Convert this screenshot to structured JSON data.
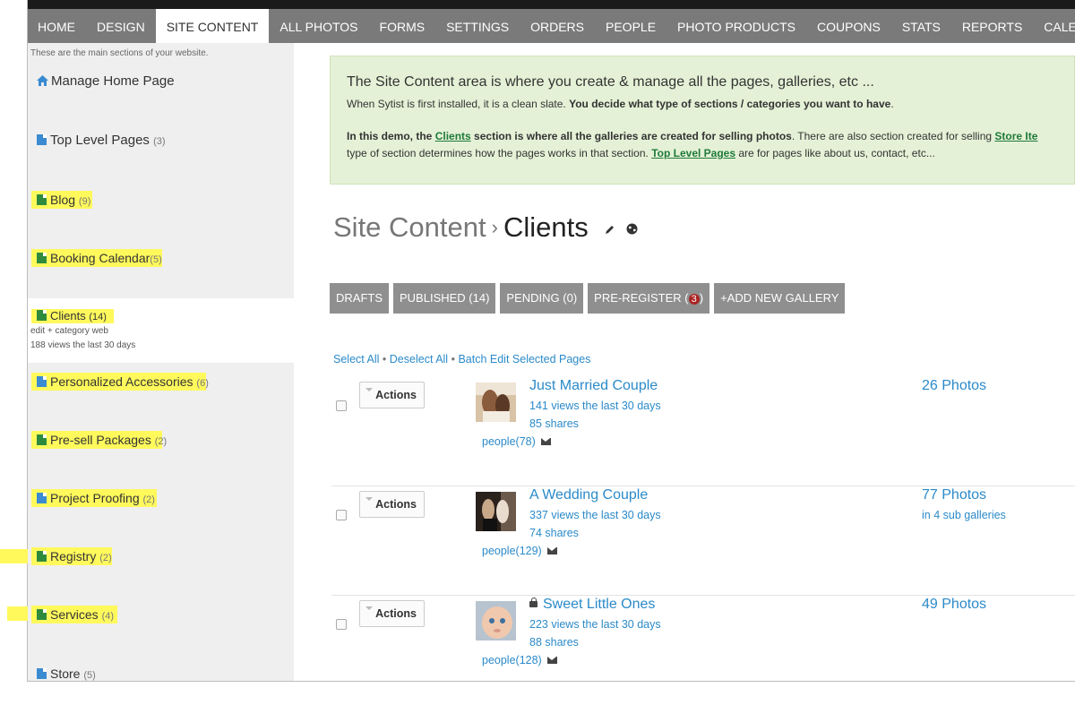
{
  "nav": {
    "items": [
      "HOME",
      "DESIGN",
      "SITE CONTENT",
      "ALL PHOTOS",
      "FORMS",
      "SETTINGS",
      "ORDERS",
      "PEOPLE",
      "PHOTO PRODUCTS",
      "COUPONS",
      "STATS",
      "REPORTS",
      "CALENDAR"
    ],
    "active": "SITE CONTENT"
  },
  "sidebar": {
    "note": "These are the main sections of your website.",
    "manage_home": "Manage Home Page",
    "items": [
      {
        "label": "Top Level Pages",
        "count": "(3)"
      },
      {
        "label": "Blog",
        "count": "(9)"
      },
      {
        "label": "Booking Calendar",
        "count": "(5)"
      },
      {
        "label": "Clients",
        "count": "(14)"
      },
      {
        "label": "Personalized Accessories",
        "count": "(6)"
      },
      {
        "label": "Pre-sell Packages",
        "count": "(2)"
      },
      {
        "label": "Project Proofing",
        "count": "(2)"
      },
      {
        "label": "Registry",
        "count": "(2)"
      },
      {
        "label": "Services",
        "count": "(4)"
      },
      {
        "label": "Store",
        "count": "(5)"
      }
    ],
    "selected_links": "edit   + category   web",
    "selected_views": "188 views the last 30 days"
  },
  "info": {
    "heading": "The Site Content area is where you create & manage all the pages, galleries, etc ...",
    "p1_normal": "When Sytist is first installed, it is a clean slate.",
    "p1_bold": "You decide what type of sections / categories you want to have",
    "p1_end": ".",
    "p2_bold_start": "In this demo, the",
    "p2_link1": "Clients",
    "p2_bold_end": "section is where all the galleries are created for selling photos",
    "p2_normal": ". There are also section created for selling",
    "p2_link2": "Store Ite",
    "p3_normal": "type of section determines how the pages works in that section.",
    "p3_link": "Top Level Pages",
    "p3_end": "are for pages like about us, contact, etc..."
  },
  "page": {
    "breadcrumb_root": "Site Content",
    "separator": "›",
    "current": "Clients"
  },
  "tabs": {
    "drafts": "DRAFTS",
    "published": "PUBLISHED (14)",
    "pending": "PENDING (0)",
    "preregister": "PRE-REGISTER (",
    "preregister_count": "3",
    "preregister_close": ")",
    "add": "+ADD NEW GALLERY"
  },
  "batch": {
    "select_all": "Select All",
    "deselect_all": "Deselect All",
    "batch_edit": "Batch Edit Selected Pages"
  },
  "galleries": [
    {
      "actions": "Actions",
      "title": "Just Married Couple",
      "views": "141 views the last 30 days",
      "shares": "85 shares",
      "people": "people(78)",
      "photos": "26 Photos",
      "sub": ""
    },
    {
      "actions": "Actions",
      "title": "A Wedding Couple",
      "views": "337 views the last 30 days",
      "shares": "74 shares",
      "people": "people(129)",
      "photos": "77 Photos",
      "sub": "in 4 sub galleries"
    },
    {
      "actions": "Actions",
      "title": "Sweet Little Ones",
      "views": "223 views the last 30 days",
      "shares": "88 shares",
      "people": "people(128)",
      "photos": "49 Photos",
      "sub": ""
    }
  ],
  "colors": {
    "nav_bg": "#7a7a7a",
    "sidebar_bg": "#efefef",
    "info_bg": "#e4f1d6",
    "link": "#2b8ac9",
    "highlight": "#fff95c",
    "tab_bg": "#8f8f8f"
  }
}
